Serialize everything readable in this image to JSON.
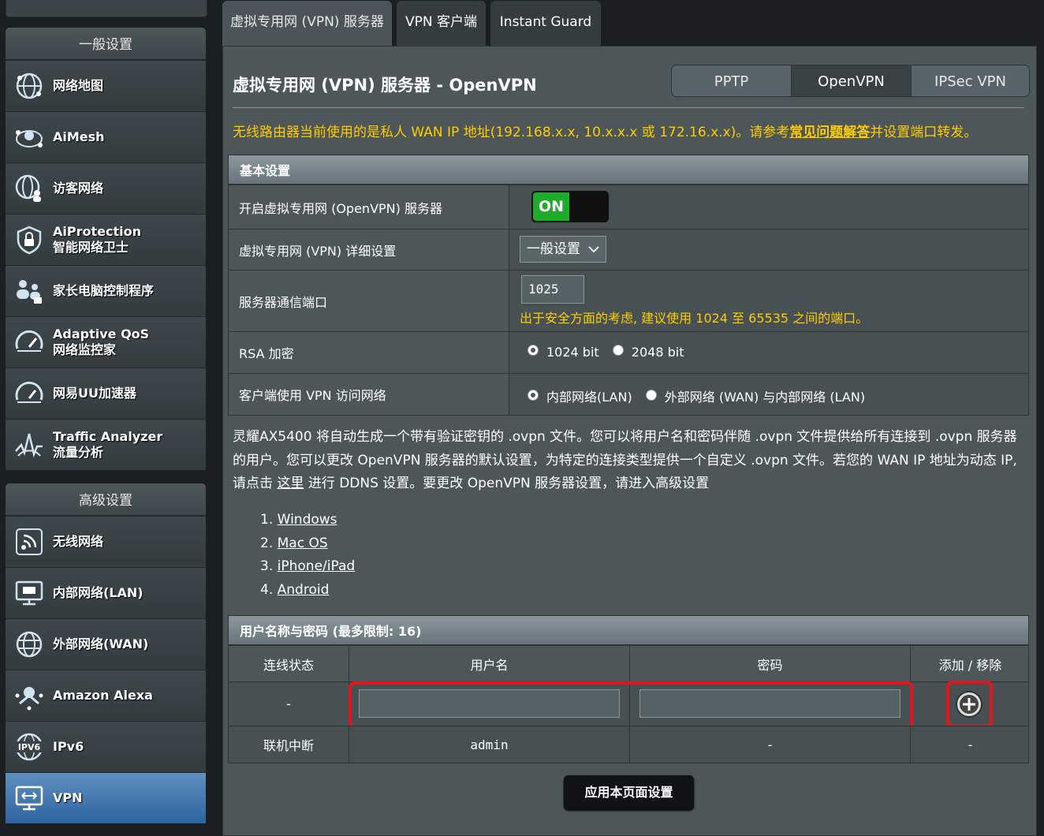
{
  "sidebar": {
    "general_header": "一般设置",
    "general_items": [
      {
        "label": "网络地图",
        "icon": "globe-network-icon"
      },
      {
        "label": "AiMesh",
        "icon": "aimesh-icon"
      },
      {
        "label": "访客网络",
        "icon": "guest-network-icon"
      },
      {
        "label": "AiProtection",
        "label2": "智能网络卫士",
        "icon": "shield-lock-icon"
      },
      {
        "label": "家长电脑控制程序",
        "icon": "parental-control-icon"
      },
      {
        "label": "Adaptive QoS",
        "label2": "网络监控家",
        "icon": "gauge-icon"
      },
      {
        "label": "网易UU加速器",
        "icon": "speed-gauge-icon"
      },
      {
        "label": "Traffic Analyzer",
        "label2": "流量分析",
        "icon": "traffic-wave-icon"
      }
    ],
    "advanced_header": "高级设置",
    "advanced_items": [
      {
        "label": "无线网络",
        "icon": "wifi-icon"
      },
      {
        "label": "内部网络(LAN)",
        "icon": "lan-monitor-icon"
      },
      {
        "label": "外部网络(WAN)",
        "icon": "wan-globe-icon"
      },
      {
        "label": "Amazon Alexa",
        "icon": "alexa-icon"
      },
      {
        "label": "IPv6",
        "icon": "ipv6-globe-icon"
      },
      {
        "label": "VPN",
        "icon": "vpn-monitor-icon",
        "active": true
      }
    ]
  },
  "tabs": [
    "虚拟专用网 (VPN) 服务器",
    "VPN 客户端",
    "Instant Guard"
  ],
  "page": {
    "title": "虚拟专用网 (VPN) 服务器 - OpenVPN",
    "protocols": [
      "PPTP",
      "OpenVPN",
      "IPSec VPN"
    ],
    "notice_pre": "无线路由器当前使用的是私人 WAN IP 地址(192.168.x.x, 10.x.x.x 或 172.16.x.x)。请参考",
    "notice_link": "常见问题解答",
    "notice_post": "并设置端口转发。"
  },
  "basic": {
    "header": "基本设置",
    "enable_label": "开启虚拟专用网 (OpenVPN) 服务器",
    "toggle_text": "ON",
    "detail_label": "虚拟专用网 (VPN) 详细设置",
    "detail_value": "一般设置",
    "port_label": "服务器通信端口",
    "port_value": "1025",
    "port_hint": "出于安全方面的考虑, 建议使用 1024 至 65535 之间的端口。",
    "rsa_label": "RSA 加密",
    "rsa_options": [
      "1024 bit",
      "2048 bit"
    ],
    "access_label": "客户端使用 VPN 访问网络",
    "access_options": [
      "内部网络(LAN)",
      "外部网络 (WAN) 与内部网络 (LAN)"
    ]
  },
  "description": {
    "line1": "灵耀AX5400 将自动生成一个带有验证密钥的 .ovpn 文件。您可以将用户名和密码伴随 .ovpn 文件提供给所有连接到 .ovpn 服务器的用户。您可以更改 OpenVPN 服务器的默认设置，为特定的连接类型提供一个自定义 .ovpn 文件。若您的 WAN IP 地址为动态 IP, 请点击 ",
    "link": "这里",
    "line2": " 进行 DDNS 设置。要更改 OpenVPN 服务器设置，请进入高级设置",
    "os": [
      {
        "n": "1.",
        "label": "Windows"
      },
      {
        "n": "2.",
        "label": "Mac OS"
      },
      {
        "n": "3.",
        "label": "iPhone/iPad"
      },
      {
        "n": "4.",
        "label": "Android"
      }
    ]
  },
  "users": {
    "header": "用户名称与密码 (最多限制: 16)",
    "columns": [
      "连线状态",
      "用户名",
      "密码",
      "添加 / 移除"
    ],
    "new_row_status": "-",
    "rows": [
      {
        "status": "联机中断",
        "username": "admin",
        "password": "-",
        "action": "-"
      }
    ]
  },
  "apply_label": "应用本页面设置"
}
